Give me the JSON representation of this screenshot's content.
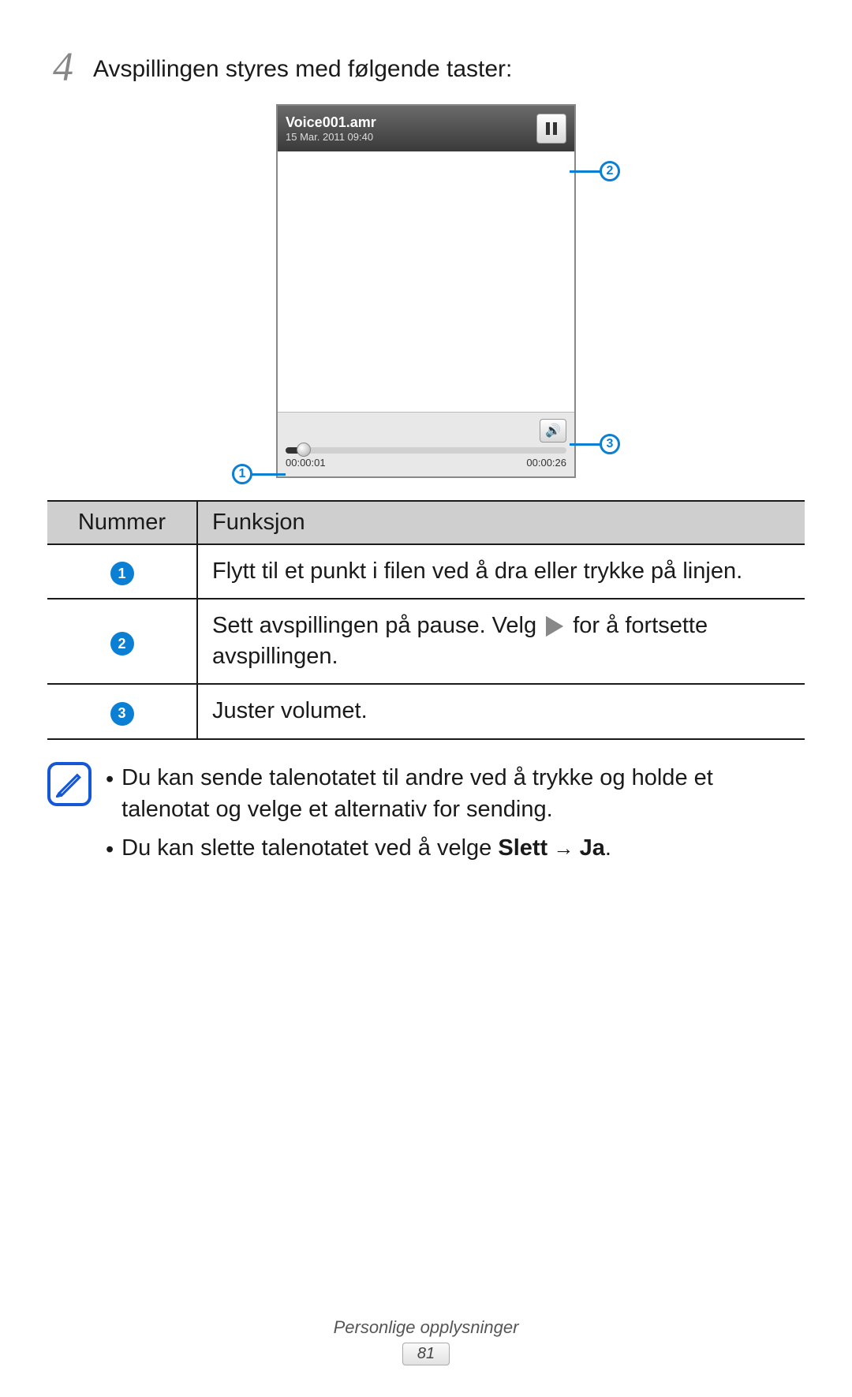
{
  "step": {
    "number": "4",
    "text": "Avspillingen styres med følgende taster:"
  },
  "phone": {
    "title": "Voice001.amr",
    "subtitle": "15 Mar. 2011 09:40",
    "time_current": "00:00:01",
    "time_total": "00:00:26"
  },
  "callouts": {
    "c1": "1",
    "c2": "2",
    "c3": "3"
  },
  "table": {
    "header_number": "Nummer",
    "header_function": "Funksjon",
    "rows": [
      {
        "badge": "1",
        "text": "Flytt til et punkt i filen ved å dra eller trykke på linjen."
      },
      {
        "badge": "2",
        "text_before": "Sett avspillingen på pause. Velg ",
        "text_after": " for å fortsette avspillingen."
      },
      {
        "badge": "3",
        "text": "Juster volumet."
      }
    ]
  },
  "note": {
    "items": [
      "Du kan sende talenotatet til andre ved å trykke og holde et talenotat og velge et alternativ for sending.",
      "Du kan slette talenotatet ved å velge Slett → Ja."
    ],
    "item2_prefix": "Du kan slette talenotatet ved å velge ",
    "item2_bold1": "Slett",
    "item2_arrow": " → ",
    "item2_bold2": "Ja",
    "item2_suffix": "."
  },
  "footer": {
    "section": "Personlige opplysninger",
    "page": "81"
  }
}
